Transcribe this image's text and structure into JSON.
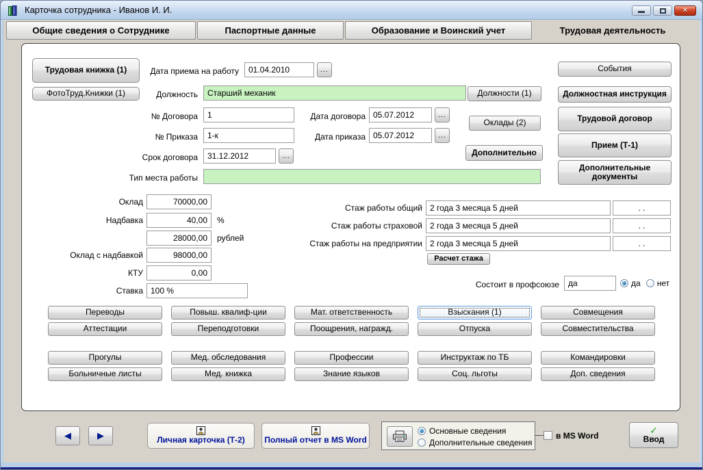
{
  "window": {
    "title": "Карточка сотрудника -  Иванов И. И."
  },
  "tabs": [
    "Общие сведения о Сотруднике",
    "Паспортные данные",
    "Образование и Воинский учет",
    "Трудовая деятельность"
  ],
  "main": {
    "trud_book_btn": "Трудовая книжка (1)",
    "photo_btn": "ФотоТруд.Книжки (1)",
    "hire": {
      "label": "Дата приема на работу",
      "value": "01.04.2010"
    },
    "position": {
      "label": "Должность",
      "value": "Старший механик",
      "btn": "Должности (1)"
    },
    "contract_no": {
      "label": "№ Договора",
      "value": "1"
    },
    "contract_date": {
      "label": "Дата договора",
      "value": "05.07.2012"
    },
    "order_no": {
      "label": "№ Приказа",
      "value": "1-к"
    },
    "order_date": {
      "label": "Дата приказа",
      "value": "05.07.2012"
    },
    "salaries_btn": "Оклады (2)",
    "extra_btn": "Дополнительно",
    "contract_term": {
      "label": "Срок договора",
      "value": "31.12.2012"
    },
    "workplace": {
      "label": "Тип места работы",
      "value": ""
    }
  },
  "right_buttons": [
    "События",
    "Должностная инструкция",
    "Трудовой договор",
    "Прием (Т-1)",
    "Дополнительные документы"
  ],
  "salary": {
    "rows": [
      {
        "label": "Оклад",
        "value": "70000,00",
        "suffix": ""
      },
      {
        "label": "Надбавка",
        "value": "40,00",
        "suffix": "%"
      },
      {
        "label": "",
        "value": "28000,00",
        "suffix": "рублей"
      },
      {
        "label": "Оклад с надбавкой",
        "value": "98000,00",
        "suffix": ""
      },
      {
        "label": "КТУ",
        "value": "0,00",
        "suffix": ""
      }
    ],
    "rate": {
      "label": "Ставка",
      "value": "100 %"
    }
  },
  "seniority": {
    "rows": [
      {
        "label": "Стаж работы общий",
        "value": "2 года 3 месяца 5 дней",
        "dates": ". ."
      },
      {
        "label": "Стаж работы страховой",
        "value": "2 года 3 месяца 5 дней",
        "dates": ". ."
      },
      {
        "label": "Стаж работы на предприятии",
        "value": "2 года 3 месяца 5 дней",
        "dates": ". ."
      }
    ],
    "calc_btn": "Расчет стажа"
  },
  "union": {
    "label": "Состоит в профсоюзе",
    "value": "да",
    "yes_label": "да",
    "no_label": "нет"
  },
  "grid": [
    [
      "Переводы",
      "Повыш. квалиф-ции",
      "Мат. ответственность",
      "Взыскания (1)",
      "Совмещения"
    ],
    [
      "Аттестации",
      "Переподготовки",
      "Поощрения, награжд.",
      "Отпуска",
      "Совместительства"
    ],
    [
      "Прогулы",
      "Мед. обследования",
      "Профессии",
      "Инструктаж по ТБ",
      "Командировки"
    ],
    [
      "Больничные листы",
      "Мед. книжка",
      "Знание языков",
      "Соц. льготы",
      "Доп. сведения"
    ]
  ],
  "bottom": {
    "personal_card_btn": "Личная карточка (Т-2)",
    "full_report_btn": "Полный отчет в MS Word",
    "radio_main": "Основные сведения",
    "radio_additional": "Дополнительные сведения",
    "word_checkbox": "в MS Word",
    "enter_btn": "Ввод"
  },
  "icons": {
    "ellipsis": "...",
    "close": "✕",
    "prev": "◀",
    "next": "▶",
    "check": "✓"
  },
  "colors": {
    "field_green": "#c9f2c1",
    "accent_blue": "#00129c",
    "check_green": "#1fa11f",
    "close_red": "#cf4526"
  }
}
